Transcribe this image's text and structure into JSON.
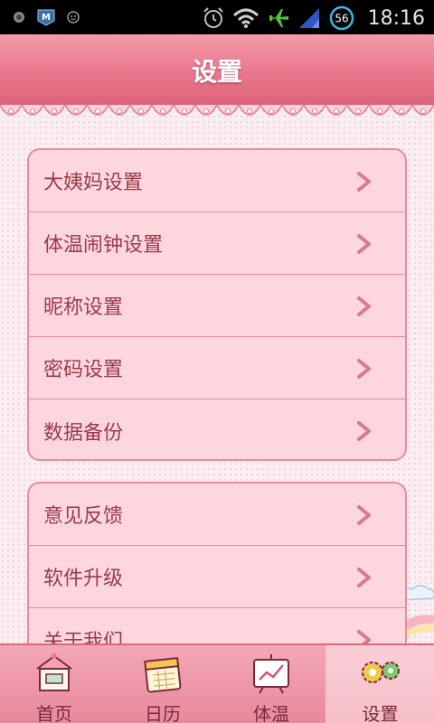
{
  "status_bar": {
    "time": "18:16",
    "network_badge": "56",
    "icons": [
      "record-icon",
      "app-m-icon",
      "smiley-icon",
      "alarm-clock-icon",
      "wifi-icon",
      "airplane-icon",
      "signal-icon"
    ]
  },
  "header": {
    "title": "设置"
  },
  "groups": [
    {
      "items": [
        {
          "label": "大姨妈设置"
        },
        {
          "label": "体温闹钟设置"
        },
        {
          "label": "昵称设置"
        },
        {
          "label": "密码设置"
        },
        {
          "label": "数据备份"
        }
      ]
    },
    {
      "items": [
        {
          "label": "意见反馈"
        },
        {
          "label": "软件升级"
        },
        {
          "label": "关于我们"
        }
      ]
    }
  ],
  "bottom_nav": {
    "tabs": [
      {
        "label": "首页",
        "icon": "home-icon"
      },
      {
        "label": "日历",
        "icon": "calendar-icon"
      },
      {
        "label": "体温",
        "icon": "temperature-chart-icon"
      },
      {
        "label": "设置",
        "icon": "gear-icon",
        "active": true
      }
    ]
  },
  "colors": {
    "header": "#e9778c",
    "row_background": "#fdd7dd",
    "row_border": "#e58d9e",
    "text": "#9a3a4c",
    "nav": "#e8889b"
  }
}
